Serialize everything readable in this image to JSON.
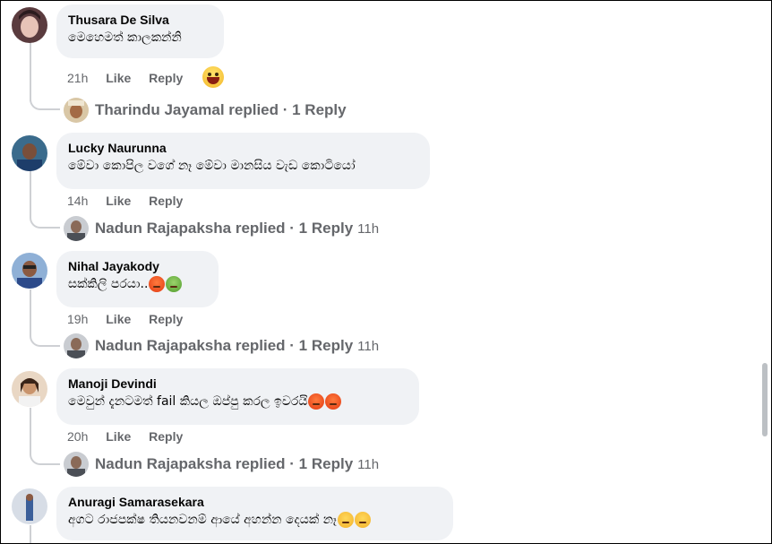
{
  "comments": [
    {
      "author": "Thusara De Silva",
      "text": "මෙහෙමත් කාලකන්නි",
      "time": "21h",
      "like": "Like",
      "reply": "Reply",
      "reaction": "grinning-face",
      "reply_summary": {
        "name": "Tharindu Jayamal",
        "label": "Tharindu Jayamal replied · 1 Reply",
        "time": ""
      }
    },
    {
      "author": "Lucky Naurunna",
      "text": "මේවා කොපිල වගේ නෑ මේවා මානසිය වැඩ කොටියෝ",
      "time": "14h",
      "like": "Like",
      "reply": "Reply",
      "reply_summary": {
        "name": "Nadun Rajapaksha",
        "label": "Nadun Rajapaksha replied · 1 Reply",
        "time": "11h"
      }
    },
    {
      "author": "Nihal Jayakody",
      "text": "සක්කිලි පරයා..",
      "emojis": [
        "angry-face",
        "nauseated-face"
      ],
      "time": "19h",
      "like": "Like",
      "reply": "Reply",
      "reply_summary": {
        "name": "Nadun Rajapaksha",
        "label": "Nadun Rajapaksha replied · 1 Reply",
        "time": "11h"
      }
    },
    {
      "author": "Manoji Devindi",
      "text": "මෙවුන් දැනටමත් fail කියල ඔප්පු කරල ඉවරයි",
      "emojis": [
        "angry-face",
        "angry-face"
      ],
      "time": "20h",
      "like": "Like",
      "reply": "Reply",
      "reply_summary": {
        "name": "Nadun Rajapaksha",
        "label": "Nadun Rajapaksha replied · 1 Reply",
        "time": "11h"
      }
    },
    {
      "author": "Anuragi Samarasekara",
      "text": "අගට රාජපක්ෂ තියනවනම් ආයේ අහන්න දෙයක් නෑ",
      "emojis": [
        "smirking-face",
        "smirking-face"
      ]
    }
  ],
  "colors": {
    "bubble": "#f0f2f5",
    "meta": "#65676b",
    "text": "#050505",
    "thread_line": "#ced0d4"
  }
}
